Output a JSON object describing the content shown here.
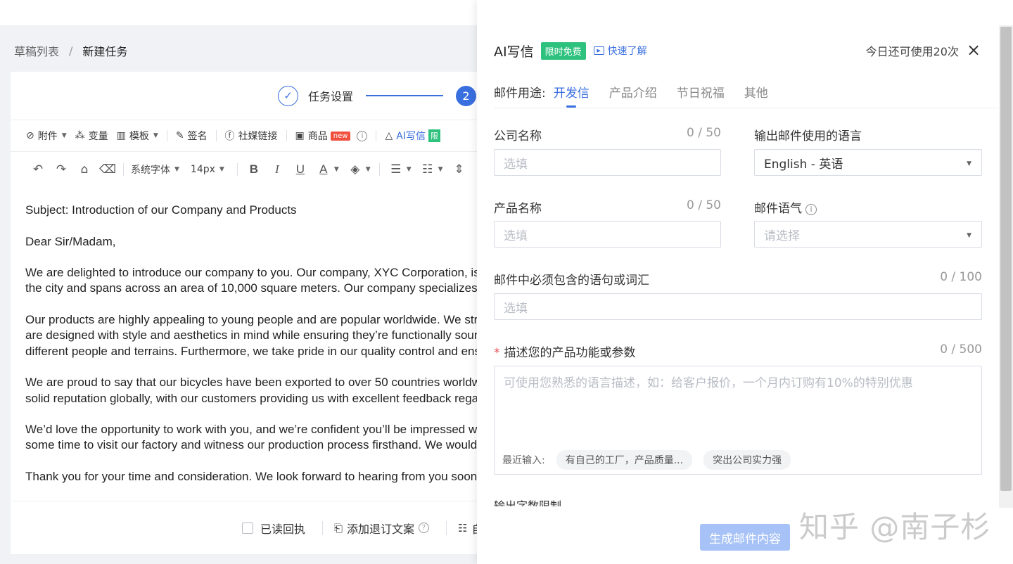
{
  "window": {
    "minimize": "—",
    "maximize": "☐",
    "close": "✕"
  },
  "breadcrumb": {
    "parent": "草稿列表",
    "separator": "/",
    "current": "新建任务"
  },
  "steps": {
    "step1_label": "任务设置",
    "step1_icon": "✓",
    "step2_num": "2"
  },
  "toolbar1": {
    "attachment": "附件",
    "variable": "变量",
    "template": "模板",
    "signature": "签名",
    "social": "社媒链接",
    "product": "商品",
    "new_badge": "new",
    "ai": "AI写信",
    "ai_badge": "限"
  },
  "toolbar2": {
    "font": "系统字体",
    "size": "14px"
  },
  "email": {
    "subject": "Subject: Introduction of our Company and Products",
    "greeting": "Dear Sir/Madam,",
    "p1": [
      "We are delighted to introduce our company to you. Our company, XYC Corporation, is a",
      "the city and spans across an area of 10,000 square meters. Our company specializes in p"
    ],
    "p2": [
      "Our products are highly appealing to young people and are popular worldwide. We stro",
      "are designed with style and aesthetics in mind while ensuring they’re functionally sound",
      "different people and terrains. Furthermore, we take pride in our quality control and ensu"
    ],
    "p3": [
      "We are proud to say that our bicycles have been exported to over 50 countries worldwid",
      "solid reputation globally, with our customers providing us with excellent feedback regar"
    ],
    "p4": [
      "We’d love the opportunity to work with you, and we’re confident you’ll be impressed wi",
      "some time to visit our factory and witness our production process firsthand. We would b"
    ],
    "closing": "Thank you for your time and consideration. We look forward to hearing from you soon."
  },
  "footer": {
    "read_receipt": "已读回执",
    "unsubscribe": "添加退订文案",
    "last": "自"
  },
  "panel": {
    "title": "AI写信",
    "free_badge": "限时免费",
    "quick_link": "快速了解",
    "usage": "今日还可使用20次",
    "purpose_label": "邮件用途:",
    "tabs": [
      "开发信",
      "产品介绍",
      "节日祝福",
      "其他"
    ],
    "company": {
      "label": "公司名称",
      "counter": "0 / 50",
      "placeholder": "选填"
    },
    "language": {
      "label": "输出邮件使用的语言",
      "value": "English - 英语"
    },
    "product": {
      "label": "产品名称",
      "counter": "0 / 50",
      "placeholder": "选填"
    },
    "tone": {
      "label": "邮件语气",
      "placeholder": "请选择"
    },
    "phrases": {
      "label": "邮件中必须包含的语句或词汇",
      "counter": "0 / 100",
      "placeholder": "选填"
    },
    "describe": {
      "required_mark": "*",
      "label": "描述您的产品功能或参数",
      "counter": "0 / 500",
      "placeholder": "可使用您熟悉的语言描述，如：给客户报价，一个月内订购有10%的特别优惠",
      "recent_label": "最近输入:",
      "recent_chips": [
        "有自己的工厂，产品质量...",
        "突出公司实力强"
      ]
    },
    "output_limit": "输出字数限制",
    "generate": "生成邮件内容"
  },
  "watermark": "知乎 @南子杉",
  "colors": {
    "accent": "#3a6fe0",
    "green_badge": "#2ec27e",
    "new_badge": "#f04f3e",
    "disabled_button": "#a7c2f6"
  }
}
